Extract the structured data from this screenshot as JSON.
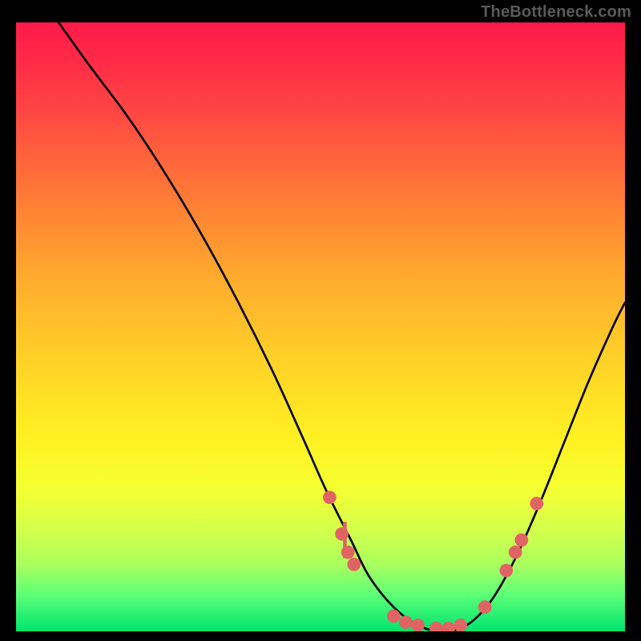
{
  "watermark": "TheBottleneck.com",
  "chart_data": {
    "type": "line",
    "title": "",
    "xlabel": "",
    "ylabel": "",
    "xlim": [
      0,
      100
    ],
    "ylim": [
      0,
      100
    ],
    "grid": false,
    "legend": false,
    "annotations": [],
    "series": [
      {
        "name": "curve",
        "color": "#000000",
        "x": [
          7,
          12,
          18,
          24,
          30,
          36,
          42,
          47,
          51,
          55,
          58,
          62,
          66,
          70,
          74,
          78,
          82,
          86,
          90,
          94,
          98,
          100
        ],
        "y": [
          100,
          93,
          85,
          76,
          66,
          55,
          43,
          32,
          23,
          15,
          9,
          4,
          1,
          0,
          1,
          5,
          12,
          21,
          31,
          41,
          50,
          54
        ]
      }
    ],
    "markers": [
      {
        "x": 51.5,
        "y": 22,
        "r": 1.1,
        "color": "#e06464"
      },
      {
        "x": 53.5,
        "y": 16,
        "r": 1.1,
        "color": "#e06464"
      },
      {
        "x": 54.5,
        "y": 13,
        "r": 1.1,
        "color": "#e06464"
      },
      {
        "x": 55.5,
        "y": 11,
        "r": 1.1,
        "color": "#e06464"
      },
      {
        "x": 62,
        "y": 2.5,
        "r": 1.1,
        "color": "#e06464"
      },
      {
        "x": 64,
        "y": 1.5,
        "r": 1.1,
        "color": "#e06464"
      },
      {
        "x": 66,
        "y": 1,
        "r": 1.1,
        "color": "#e06464"
      },
      {
        "x": 69,
        "y": 0.5,
        "r": 1.1,
        "color": "#e06464"
      },
      {
        "x": 71,
        "y": 0.5,
        "r": 1.1,
        "color": "#e06464"
      },
      {
        "x": 73,
        "y": 1,
        "r": 1.1,
        "color": "#e06464"
      },
      {
        "x": 77,
        "y": 4,
        "r": 1.1,
        "color": "#e06464"
      },
      {
        "x": 80.5,
        "y": 10,
        "r": 1.1,
        "color": "#e06464"
      },
      {
        "x": 82,
        "y": 13,
        "r": 1.1,
        "color": "#e06464"
      },
      {
        "x": 83,
        "y": 15,
        "r": 1.1,
        "color": "#e06464"
      },
      {
        "x": 85.5,
        "y": 21,
        "r": 1.1,
        "color": "#e06464"
      }
    ],
    "bars": [
      {
        "x": 54,
        "y0": 12,
        "y1": 18,
        "w": 0.6,
        "color": "#e06464"
      }
    ]
  }
}
